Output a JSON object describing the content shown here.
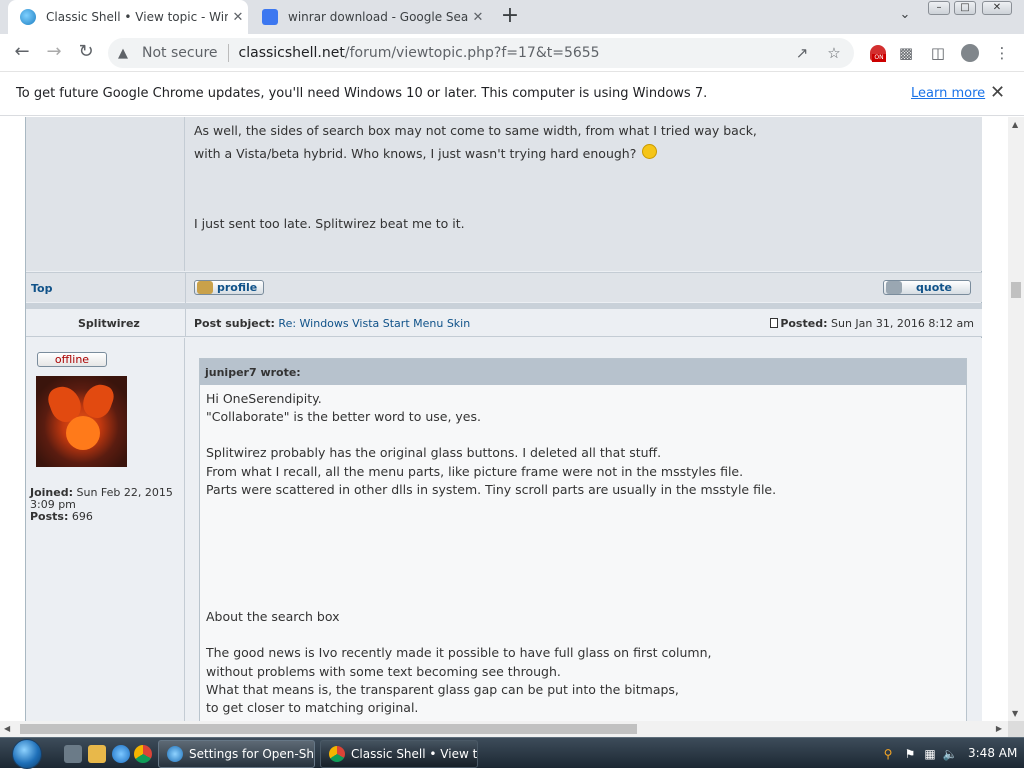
{
  "tabs": [
    {
      "title": "Classic Shell • View topic - Windows",
      "active": true
    },
    {
      "title": "winrar download - Google Search",
      "active": false
    }
  ],
  "tabstrip": {
    "new_tab": "+",
    "tab_search": "⌄",
    "close": "✕"
  },
  "window_controls": {
    "minimize": "–",
    "maximize": "□",
    "close": "✕"
  },
  "toolbar": {
    "back": "←",
    "forward": "→",
    "reload": "↻",
    "security_label": "Not secure",
    "url_host": "classicshell.net",
    "url_path": "/forum/viewtopic.php?f=17&t=5655",
    "extension_badge": "ON"
  },
  "infobar": {
    "message": "To get future Google Chrome updates, you'll need Windows 10 or later. This computer is using Windows 7.",
    "learn_more": "Learn more",
    "close": "✕"
  },
  "post1": {
    "lines": [
      "As well, the sides of search box may not come to same width, from what I tried way back,",
      "with a Vista/beta hybrid. Who knows, I just wasn't trying hard enough?",
      "I just sent too late. Splitwirez beat me to it."
    ],
    "top_link": "Top",
    "profile_button": "profile",
    "quote_button": "quote"
  },
  "post2": {
    "author": "Splitwirez",
    "subject_label": "Post subject:",
    "subject": "Re: Windows Vista Start Menu Skin",
    "posted_label": "Posted:",
    "posted": "Sun Jan 31, 2016 8:12 am",
    "status": "offline",
    "joined_label": "Joined:",
    "joined_date": "Sun Feb 22, 2015",
    "joined_time": "3:09 pm",
    "posts_label": "Posts:",
    "posts": "696",
    "quote_header": "juniper7 wrote:",
    "quote_lines": [
      "Hi OneSerendipity.",
      "\"Collaborate\" is the better word to use, yes.",
      "Splitwirez probably has the original glass buttons. I deleted all that stuff.",
      "From what I recall, all the menu parts, like picture frame were not in the msstyles file.",
      "Parts were scattered in other dlls in system. Tiny scroll parts are usually in the msstyle file.",
      "About the search box",
      "The good news is Ivo recently made it possible to have full glass on first column,",
      "without problems with some text becoming see through.",
      "What that means is, the transparent glass gap can be put into the bitmaps,",
      "to get closer to matching original."
    ]
  },
  "taskbar": {
    "items": [
      {
        "label": "Settings for Open-Sh...",
        "active": false
      },
      {
        "label": "Classic Shell • View t...",
        "active": true
      }
    ],
    "clock": "3:48 AM"
  },
  "colors": {
    "link": "#105289",
    "post_bg": "#dfe3e8",
    "quote_header_bg": "#b7c2cd",
    "chrome_link": "#1a73e8"
  },
  "icons": [
    "globe-favicon",
    "google-favicon",
    "warning-icon",
    "share-icon",
    "star-icon",
    "santa-extension-icon",
    "puzzle-icon",
    "sidepanel-icon",
    "account-icon",
    "menu-icon",
    "post-doc-icon",
    "smiley-icon"
  ]
}
